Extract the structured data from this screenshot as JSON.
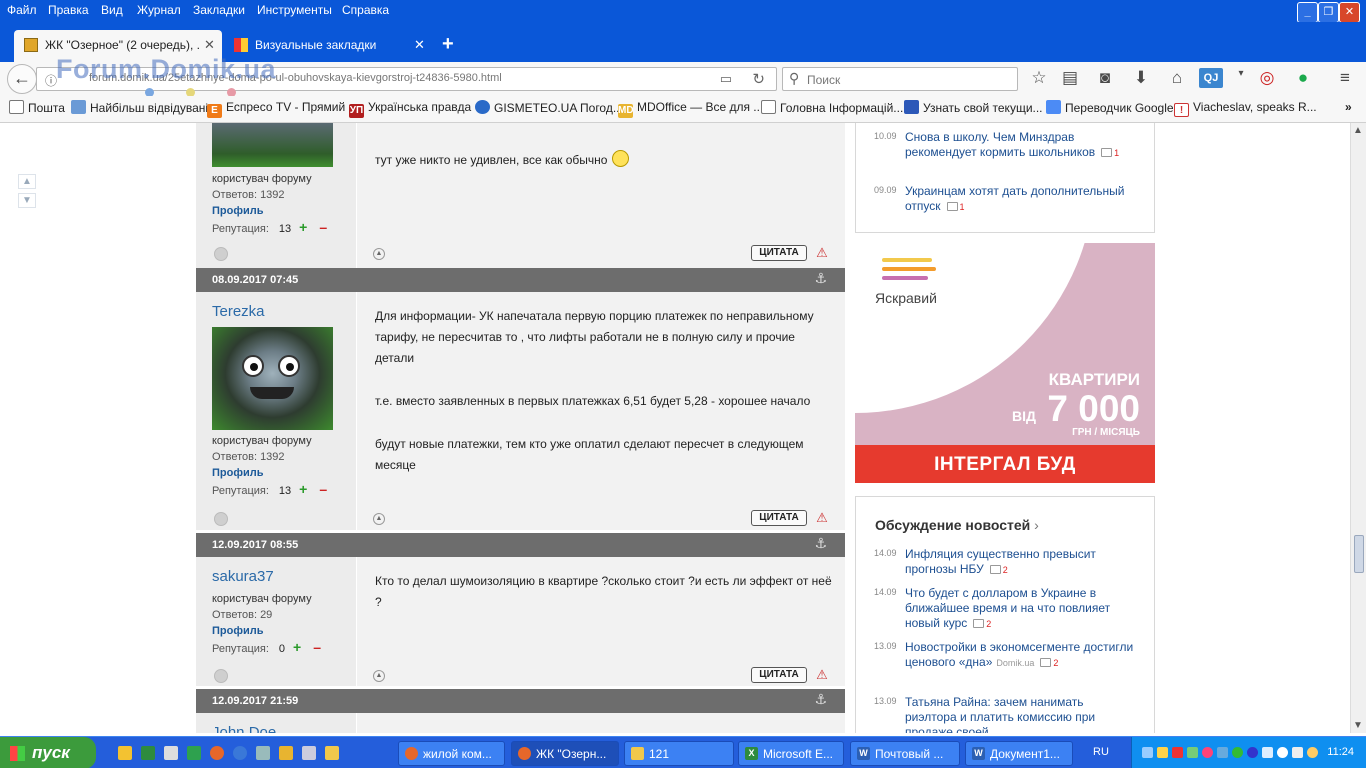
{
  "menu": {
    "items": [
      "Файл",
      "Правка",
      "Вид",
      "Журнал",
      "Закладки",
      "Инструменты",
      "Справка"
    ]
  },
  "tabs": [
    {
      "title": "ЖК \"Озерное\" (2 очередь), ..."
    },
    {
      "title": "Визуальные закладки"
    }
  ],
  "address": {
    "url": "forum.domik.ua/25etazhnye-doma-po-ul-obuhovskaya-kievgorstroj-t24836-5980.html",
    "watermark": "Forum.Domik.ua"
  },
  "search": {
    "placeholder": "Поиск"
  },
  "bookmarks": [
    "Пошта",
    "Найбільш відвідувані",
    "Еспресо TV - Прямий ...",
    "Українська правда",
    "GISMETEO.UA Погод...",
    "MDOffice — Все для ...",
    "Головна Інформацій...",
    "Узнать свой текущи...",
    "Переводчик Google",
    "Viacheslav, speaks R..."
  ],
  "posts": [
    {
      "author": "",
      "role": "користувач форуму",
      "replies_label": "Ответов:",
      "replies": "1392",
      "profile": "Профиль",
      "rep_label": "Репутация:",
      "rep": "13",
      "text": [
        "тут уже никто не удивлен, все как обычно"
      ],
      "quote": "ЦИТАТА"
    },
    {
      "date": "08.09.2017 07:45",
      "author": "Terezka",
      "role": "користувач форуму",
      "replies_label": "Ответов:",
      "replies": "1392",
      "profile": "Профиль",
      "rep_label": "Репутация:",
      "rep": "13",
      "text": [
        "Для информации- УК напечатала первую порцию платежек по неправильному тарифу, не пересчитав то , что лифты работали не в полную силу и прочие детали",
        "т.е. вместо заявленных в первых платежках 6,51 будет 5,28 - хорошее начало",
        "будут новые платежки, тем кто уже оплатил сделают пересчет в следующем месяце"
      ],
      "quote": "ЦИТАТА"
    },
    {
      "date": "12.09.2017 08:55",
      "author": "sakura37",
      "role": "користувач форуму",
      "replies_label": "Ответов:",
      "replies": "29",
      "profile": "Профиль",
      "rep_label": "Репутация:",
      "rep": "0",
      "text": [
        "Кто то делал шумоизоляцию в квартире ?сколько стоит ?и есть ли эффект от неё ?"
      ],
      "quote": "ЦИТАТА"
    },
    {
      "date": "12.09.2017 21:59",
      "author": "John Doe"
    }
  ],
  "rep_plus": "+",
  "rep_minus": "–",
  "news_top": [
    {
      "date": "10.09",
      "title": "Снова в школу. Чем Минздрав рекомендует кормить школьников",
      "comments": "1"
    },
    {
      "date": "09.09",
      "title": "Украинцам хотят дать дополнительный отпуск",
      "comments": "1"
    }
  ],
  "ad": {
    "brand": "Яскравий",
    "headline": "КВАРТИРИ",
    "from": "ВІД",
    "price": "7 000",
    "unit": "ГРН / МІСЯЦЬ",
    "logo": "ІНТЕРГАЛ БУД"
  },
  "news_discussion": {
    "title": "Обсуждение новостей",
    "items": [
      {
        "date": "14.09",
        "title": "Инфляция существенно превысит прогнозы НБУ",
        "comments": "2"
      },
      {
        "date": "14.09",
        "title": "Что будет с долларом в Украине в ближайшее время и на что повлияет новый курс",
        "comments": "2"
      },
      {
        "date": "13.09",
        "title": "Новостройки в экономсегменте достигли ценового «дна»",
        "source": "Domik.ua",
        "comments": "2"
      },
      {
        "date": "13.09",
        "title": "Татьяна Райна: зачем нанимать риэлтора и платить комиссию при продаже своей",
        "comments": ""
      }
    ]
  },
  "taskbar": {
    "start": "пуск",
    "tasks": [
      "жилой ком...",
      "ЖК \"Озерн...",
      "121",
      "Microsoft E...",
      "Почтовый ...",
      "Документ1..."
    ],
    "lang": "RU",
    "clock": "11:24"
  },
  "colors": {
    "menubar": "#0a57d8",
    "date_bar": "#6d6d6d",
    "link": "#1d4f91",
    "ad_red": "#e63a2e",
    "ad_pink": "#d9b3c4",
    "taskbar": "#245edb"
  }
}
